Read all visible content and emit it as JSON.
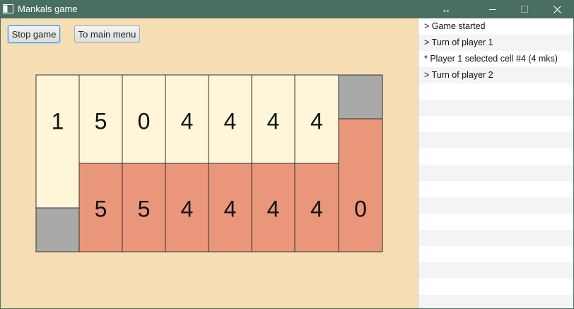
{
  "window": {
    "title": "Mankals game",
    "icon": "app-window-icon",
    "controls": {
      "resize_icon": "↔",
      "minimize": "minimize-icon",
      "maximize": "maximize-icon",
      "close": "close-icon"
    }
  },
  "toolbar": {
    "stop_label": "Stop game",
    "menu_label": "To main menu"
  },
  "board": {
    "top_store": "1",
    "top_pits": [
      "5",
      "0",
      "4",
      "4",
      "4",
      "4"
    ],
    "bottom_pits": [
      "5",
      "5",
      "4",
      "4",
      "4",
      "4"
    ],
    "bottom_store": "0"
  },
  "log": {
    "entries": [
      "> Game started",
      "> Turn of player 1",
      "* Player 1 selected cell #4 (4 mks)",
      "> Turn of player 2"
    ]
  },
  "colors": {
    "titlebar": "#4a6e5f",
    "background": "#f5deb3",
    "player1_cell": "#fff6da",
    "player2_cell": "#e9967a",
    "empty_store": "#a9a9a9"
  }
}
